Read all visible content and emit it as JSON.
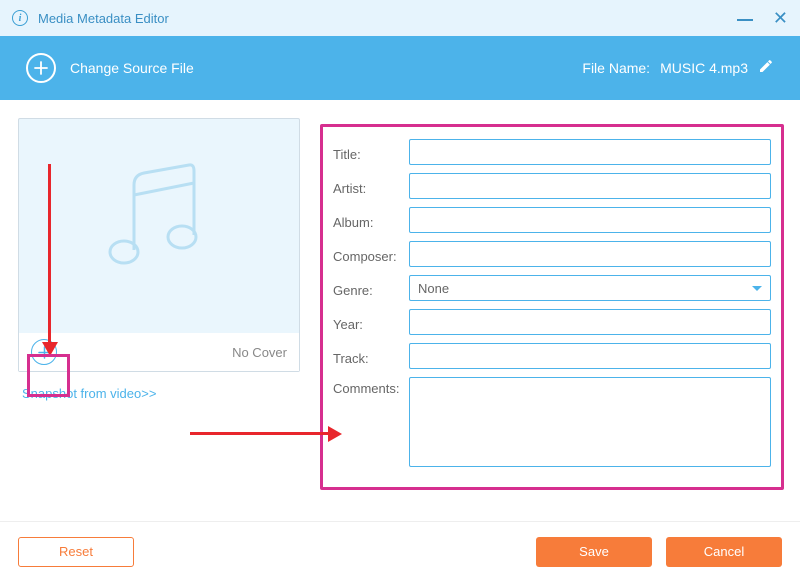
{
  "titlebar": {
    "title": "Media Metadata Editor"
  },
  "toolbar": {
    "change_source_label": "Change Source File",
    "filename_label": "File Name:",
    "filename_value": "MUSIC 4.mp3"
  },
  "cover": {
    "no_cover_label": "No Cover",
    "snapshot_link": "Snapshot from video>>"
  },
  "form": {
    "title_label": "Title:",
    "artist_label": "Artist:",
    "album_label": "Album:",
    "composer_label": "Composer:",
    "genre_label": "Genre:",
    "genre_value": "None",
    "year_label": "Year:",
    "track_label": "Track:",
    "comments_label": "Comments:",
    "values": {
      "title": "",
      "artist": "",
      "album": "",
      "composer": "",
      "year": "",
      "track": "",
      "comments": ""
    }
  },
  "footer": {
    "reset_label": "Reset",
    "save_label": "Save",
    "cancel_label": "Cancel"
  }
}
